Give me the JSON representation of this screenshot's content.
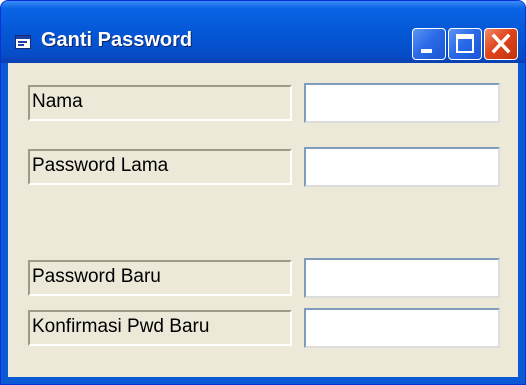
{
  "window": {
    "title": "Ganti Password",
    "buttons": {
      "minimize": "minimize",
      "maximize": "maximize",
      "close": "close"
    }
  },
  "form": {
    "fields": [
      {
        "label": "Nama",
        "value": ""
      },
      {
        "label": "Password Lama",
        "value": ""
      },
      {
        "label": "Password Baru",
        "value": ""
      },
      {
        "label": "Konfirmasi Pwd Baru",
        "value": ""
      }
    ]
  },
  "colors": {
    "title_bar": "#0559d8",
    "client_background": "#ece9d8",
    "close_button": "#e0451c",
    "input_border": "#7f9db9"
  }
}
